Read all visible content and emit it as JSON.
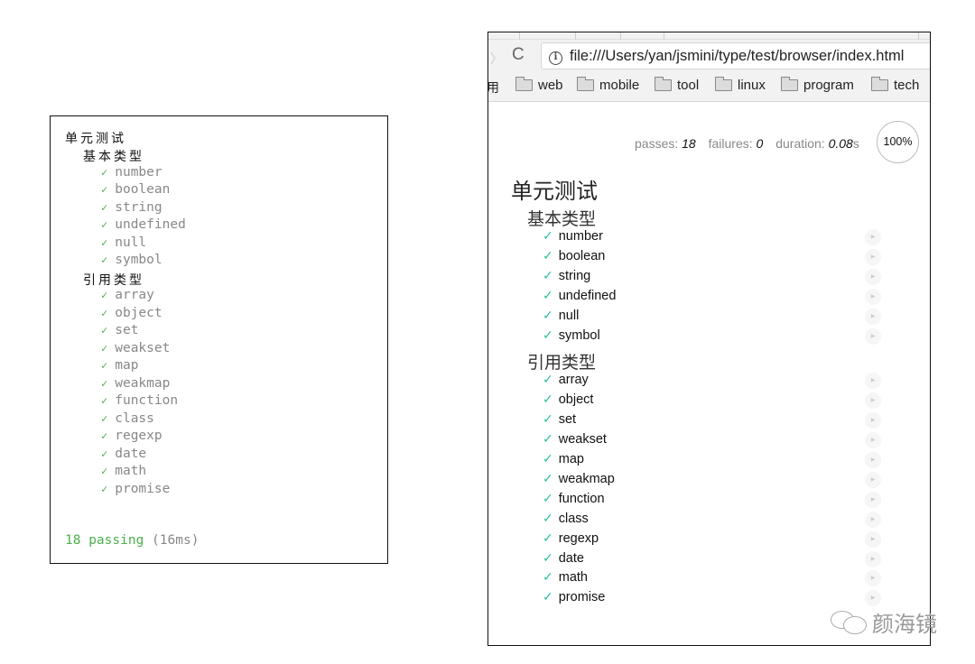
{
  "terminal": {
    "root_suite": "单元测试",
    "suites": [
      {
        "title": "基本类型",
        "tests": [
          "number",
          "boolean",
          "string",
          "undefined",
          "null",
          "symbol"
        ]
      },
      {
        "title": "引用类型",
        "tests": [
          "array",
          "object",
          "set",
          "weakset",
          "map",
          "weakmap",
          "function",
          "class",
          "regexp",
          "date",
          "math",
          "promise"
        ]
      }
    ],
    "check_glyph": "✓",
    "summary_passing": "18 passing",
    "summary_duration": "(16ms)"
  },
  "browser": {
    "forward_icon": "〉",
    "reload_icon": "C",
    "info_icon": "i",
    "url": "file:///Users/yan/jsmini/type/test/browser/index.html",
    "bookmark_cut": "用",
    "bookmarks": [
      "web",
      "mobile",
      "tool",
      "linux",
      "program",
      "tech"
    ],
    "stats": {
      "passes_label": "passes:",
      "passes_value": "18",
      "failures_label": "failures:",
      "failures_value": "0",
      "duration_label": "duration:",
      "duration_value": "0.08",
      "duration_unit": "s",
      "progress": "100%"
    },
    "root_suite": "单元测试",
    "suites": [
      {
        "title": "基本类型",
        "tests": [
          "number",
          "boolean",
          "string",
          "undefined",
          "null",
          "symbol"
        ]
      },
      {
        "title": "引用类型",
        "tests": [
          "array",
          "object",
          "set",
          "weakset",
          "map",
          "weakmap",
          "function",
          "class",
          "regexp",
          "date",
          "math",
          "promise"
        ]
      }
    ],
    "check_glyph": "✓",
    "replay_glyph": "▶"
  },
  "watermark": {
    "text": "颜海镜"
  },
  "colors": {
    "terminal_pass": "#4cb04c",
    "mocha_check": "#2fc0a0"
  }
}
